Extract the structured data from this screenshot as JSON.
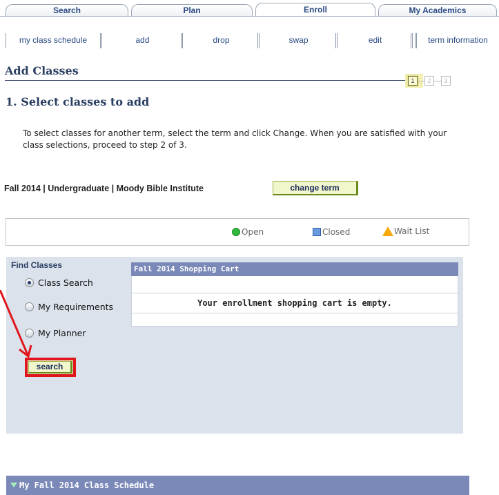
{
  "tabs": [
    {
      "label": "Search"
    },
    {
      "label": "Plan"
    },
    {
      "label": "Enroll"
    },
    {
      "label": "My Academics"
    }
  ],
  "subtabs": [
    {
      "label": "my class schedule"
    },
    {
      "label": "add"
    },
    {
      "label": "drop"
    },
    {
      "label": "swap"
    },
    {
      "label": "edit"
    },
    {
      "label": "term information"
    }
  ],
  "page_title": "Add Classes",
  "steps": [
    "1",
    "2",
    "3"
  ],
  "section_title": "1.  Select classes to add",
  "instructions": "To select classes for another term, select the term and click Change.  When you are satisfied with your class selections, proceed to step 2 of 3.",
  "term_line": "Fall 2014 | Undergraduate | Moody Bible Institute",
  "change_term_label": "change term",
  "legend": {
    "open": "Open",
    "closed": "Closed",
    "wait_list": "Wait List",
    "colors": {
      "open": "#2fb83a",
      "closed": "#6a9ae0",
      "wait": "#f6a90d"
    }
  },
  "find_classes": {
    "title": "Find Classes",
    "options": [
      {
        "label": "Class Search",
        "selected": true
      },
      {
        "label": "My Requirements",
        "selected": false
      },
      {
        "label": "My Planner",
        "selected": false
      }
    ],
    "search_label": "search"
  },
  "cart": {
    "title": "Fall 2014 Shopping Cart",
    "empty_message": "Your enrollment shopping cart is empty."
  },
  "schedule_bar": "My Fall 2014 Class Schedule",
  "annotation": {
    "color": "#e0161c"
  }
}
